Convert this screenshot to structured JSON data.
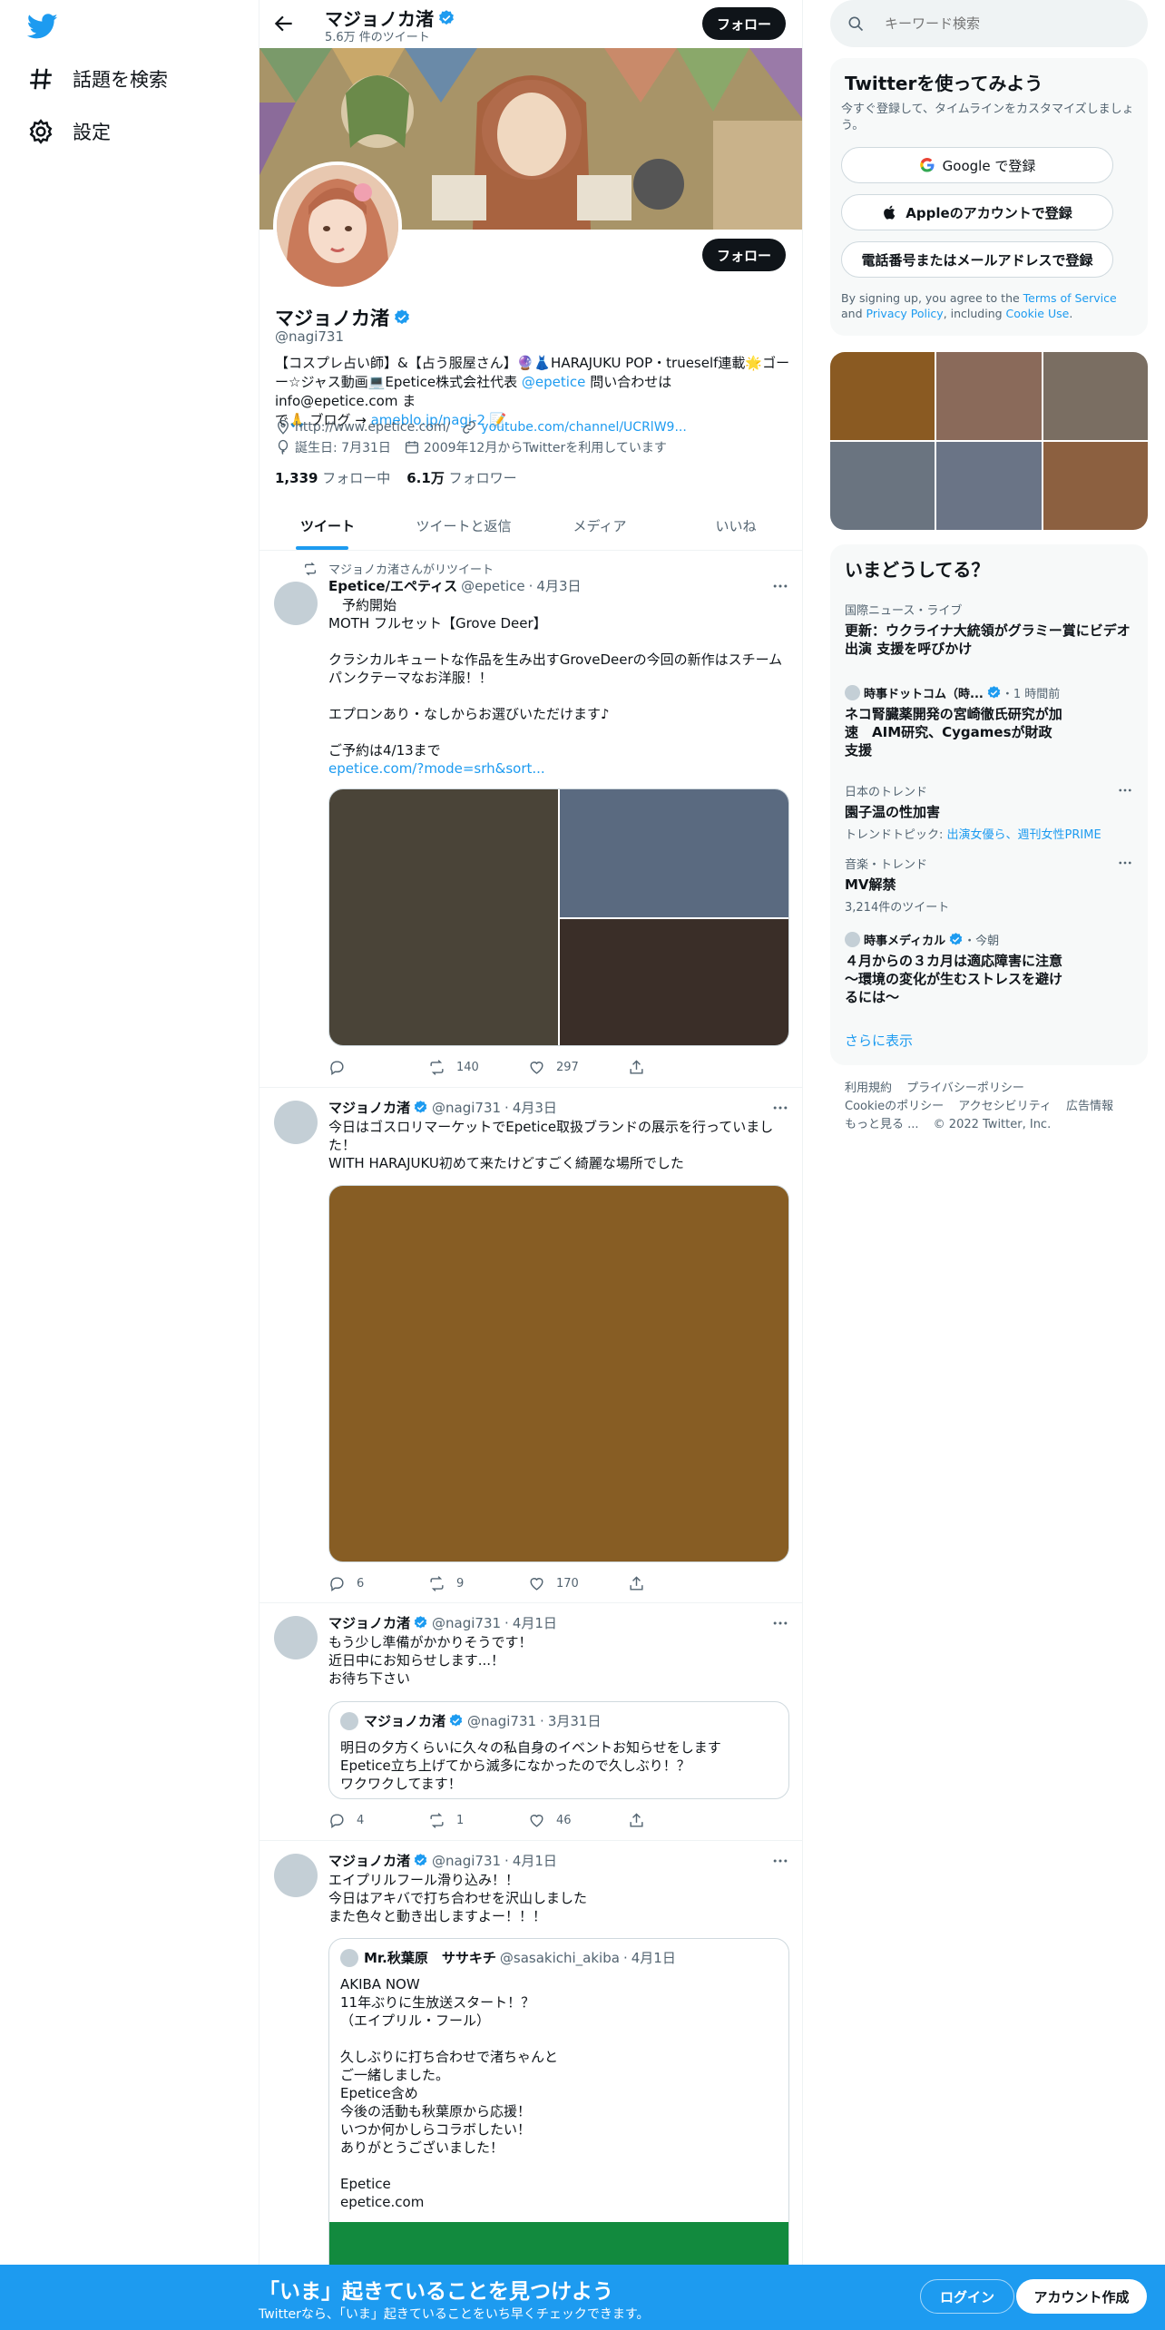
{
  "nav": {
    "explore_label": "話題を検索",
    "settings_label": "設定"
  },
  "header": {
    "name": "マジョノカ渚",
    "tweet_count": "5.6万 件のツイート",
    "follow_label": "フォロー"
  },
  "profile": {
    "name": "マジョノカ渚",
    "handle": "@nagi731",
    "follow_label": "フォロー",
    "bio_line1": "【コスプレ占い師】&【占う服屋さん】🔮👗HARAJUKU POP・trueself連載🌟ゴー",
    "bio_line2_pre": "ー☆ジャス動画💻Epetice株式会社代表 ",
    "bio_mention": "@epetice",
    "bio_line2_post": " 問い合わせはinfo@epetice.com ま",
    "bio_line3_pre": "で🙏 ブログ → ",
    "bio_link": "ameblo.jp/nagi-2",
    "bio_line3_post": " 📝",
    "website": "http://www.epetice.com/",
    "youtube": "youtube.com/channel/UCRlW9...",
    "birthday": "誕生日: 7月31日",
    "joined": "2009年12月からTwitterを利用しています",
    "following_count": "1,339",
    "following_label": "フォロー中",
    "followers_count": "6.1万",
    "followers_label": "フォロワー"
  },
  "tabs": [
    "ツイート",
    "ツイートと返信",
    "メディア",
    "いいね"
  ],
  "tweets": [
    {
      "retweet_label": "マジョノカ渚さんがリツイート",
      "name": "Epetice/エペティス",
      "handle": "@epetice",
      "date": "4月3日",
      "text": "　予約開始\nMOTH フルセット【Grove Deer】\n\nクラシカルキュートな作品を生み出すGroveDeerの今回の新作はスチーム\nパンクテーマなお洋服！！\n\nエプロンあり・なしからお選びいただけます♪\n\nご予約は4/13まで",
      "link": "epetice.com/?mode=srh&sort...",
      "replies": "",
      "retweets": "140",
      "likes": "297"
    },
    {
      "name": "マジョノカ渚",
      "handle": "@nagi731",
      "date": "4月3日",
      "text": "今日はゴスロリマーケットでEpetice取扱ブランドの展示を行っていまし\nた！\nWITH HARAJUKU初めて来たけどすごく綺麗な場所でした",
      "replies": "6",
      "retweets": "9",
      "likes": "170"
    },
    {
      "name": "マジョノカ渚",
      "handle": "@nagi731",
      "date": "4月1日",
      "text": "もう少し準備がかかりそうです！\n近日中にお知らせします...！\nお待ち下さい",
      "quote_name": "マジョノカ渚",
      "quote_handle": "@nagi731",
      "quote_date": "3月31日",
      "quote_text": "明日の夕方くらいに久々の私自身のイベントお知らせをします\nEpetice立ち上げてから滅多になかったので久しぶり！？\nワクワクしてます！",
      "replies": "4",
      "retweets": "1",
      "likes": "46"
    },
    {
      "name": "マジョノカ渚",
      "handle": "@nagi731",
      "date": "4月1日",
      "text": "エイプリルフール滑り込み！！\n今日はアキバで打ち合わせを沢山しました\nまた色々と動き出しますよー！！！",
      "quote_name": "Mr.秋葉原　ササキチ",
      "quote_handle": "@sasakichi_akiba",
      "quote_date": "4月1日",
      "quote_text": "AKIBA NOW\n11年ぶりに生放送スタート！？\n（エイプリル・フール）\n\n久しぶりに打ち合わせで渚ちゃんと\nご一緒しました。\nEpetice含め\n今後の活動も秋葉原から応援！\nいつか何かしらコラボしたい！\nありがとうございました！\n\nEpetice\nepetice.com"
    }
  ],
  "search": {
    "placeholder": "キーワード検索"
  },
  "signup": {
    "title": "Twitterを使ってみよう",
    "desc": "今すぐ登録して、タイムラインをカスタマイズしましょう。",
    "google": "Google で登録",
    "apple": "Appleのアカウントで登録",
    "phone": "電話番号またはメールアドレスで登録",
    "legal_pre": "By signing up, you agree to the ",
    "terms": "Terms of Service",
    "legal_and": " and ",
    "privacy": "Privacy Policy",
    "legal_inc": ", including ",
    "cookie": "Cookie Use",
    "legal_end": "."
  },
  "trends": {
    "title": "いまどうしてる？",
    "items": [
      {
        "category": "国際ニュース・ライブ",
        "title": "更新：ウクライナ大統領がグラミー賞にビデオ出演 支援を呼びかけ"
      },
      {
        "source": "時事ドットコム（時...",
        "time": "・1 時間前",
        "title": "ネコ腎臓薬開発の宮崎徹氏研究が加速　AIM研究、Cygamesが財政支援"
      },
      {
        "category": "日本のトレンド",
        "title": "園子温の性加害",
        "sub_label": "トレンドトピック: ",
        "sub_links": "出演女優ら、週刊女性PRIME"
      },
      {
        "category": "音楽・トレンド",
        "title": "MV解禁",
        "sub": "3,214件のツイート"
      },
      {
        "source": "時事メディカル",
        "time": "・今朝",
        "title": "４月からの３カ月は適応障害に注意～環境の変化が生むストレスを避けるには～"
      }
    ],
    "show_more": "さらに表示"
  },
  "footer": {
    "links1": [
      "利用規約",
      "プライバシーポリシー"
    ],
    "links2": [
      "Cookieのポリシー",
      "アクセシビリティ",
      "広告情報"
    ],
    "more": "もっと見る ...",
    "copyright": "© 2022 Twitter, Inc."
  },
  "bottom_bar": {
    "title": "「いま」起きていることを見つけよう",
    "subtitle": "Twitterなら、「いま」起きていることをいち早くチェックできます。",
    "login": "ログイン",
    "signup": "アカウント作成"
  },
  "colors": {
    "accent": "#1d9bf0",
    "text": "#0f1419",
    "muted": "#536471",
    "button_dark": "#0f1419"
  }
}
